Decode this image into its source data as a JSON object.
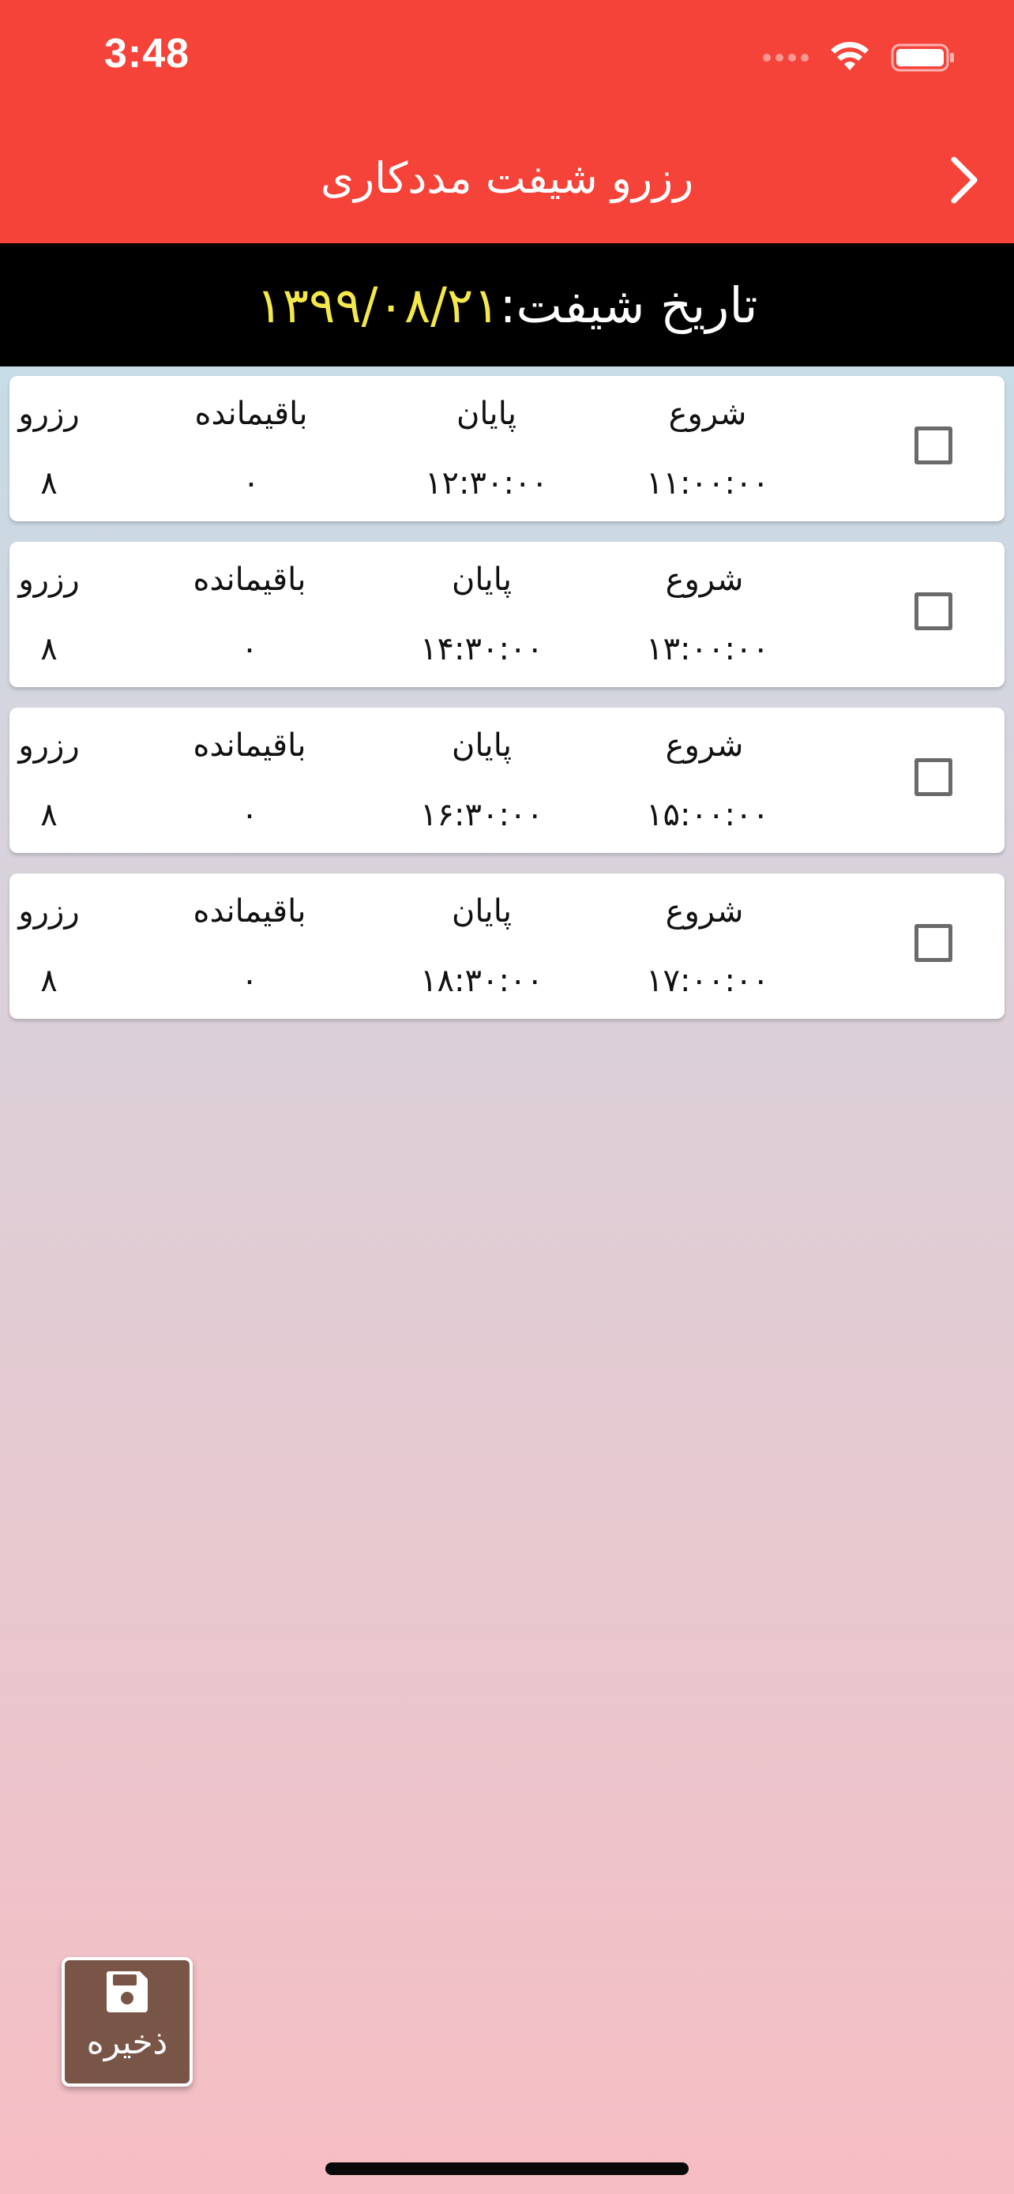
{
  "status_bar": {
    "time": "3:48"
  },
  "header": {
    "title": "رزرو شیفت مددکاری",
    "back_icon": "chevron-right-icon"
  },
  "date_bar": {
    "label": "تاریخ شیفت:",
    "value": "۱۳۹۹/۰۸/۲۱"
  },
  "columns": {
    "start": "شروع",
    "end": "پایان",
    "remaining": "باقیمانده",
    "reserve": "رزرو"
  },
  "shifts": [
    {
      "start": "۱۱:۰۰:۰۰",
      "end": "۱۲:۳۰:۰۰",
      "remaining": "۰",
      "reserve": "۸",
      "checked": false
    },
    {
      "start": "۱۳:۰۰:۰۰",
      "end": "۱۴:۳۰:۰۰",
      "remaining": "۰",
      "reserve": "۸",
      "checked": false
    },
    {
      "start": "۱۵:۰۰:۰۰",
      "end": "۱۶:۳۰:۰۰",
      "remaining": "۰",
      "reserve": "۸",
      "checked": false
    },
    {
      "start": "۱۷:۰۰:۰۰",
      "end": "۱۸:۳۰:۰۰",
      "remaining": "۰",
      "reserve": "۸",
      "checked": false
    }
  ],
  "save_button": {
    "label": "ذخیره",
    "icon": "floppy-disk-icon"
  },
  "colors": {
    "header": "#f5433a",
    "date_bar": "#000000",
    "date_value": "#f5e84a",
    "save_button": "#795548"
  }
}
